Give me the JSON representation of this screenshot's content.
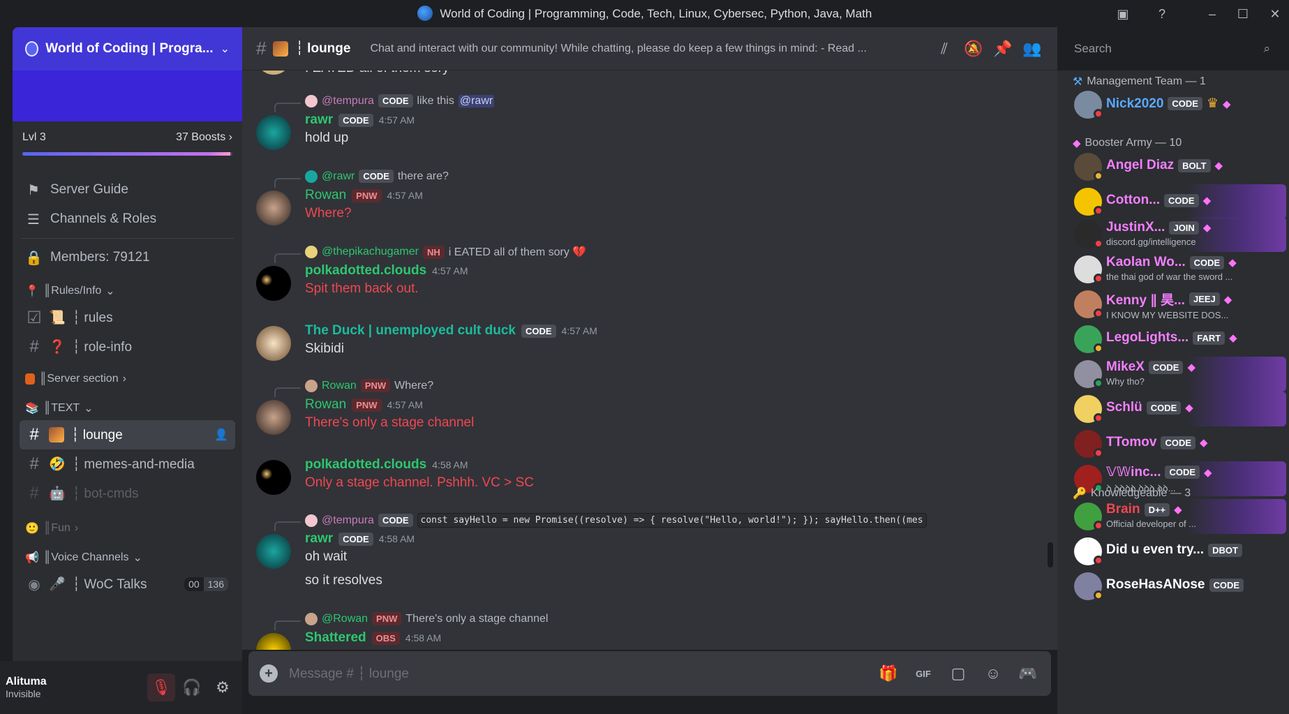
{
  "window": {
    "title": "World of Coding | Programming, Code, Tech, Linux, Cybersec, Python, Java, Math"
  },
  "server": {
    "name": "World of Coding | Progra...",
    "level": "Lvl 3",
    "boosts": "37 Boosts",
    "boost_progress": 0.99
  },
  "sidebar": {
    "items": [
      {
        "label": "Server Guide"
      },
      {
        "label": "Channels & Roles"
      },
      {
        "label": "Members: 79121"
      }
    ],
    "categories": {
      "rules_info": "║Rules/Info",
      "server_section": "║Server section",
      "text": "║TEXT",
      "fun": "║Fun",
      "voice": "║Voice Channels"
    },
    "channels": {
      "rules": "┆ rules",
      "role_info": "┆ role-info",
      "lounge": "┆ lounge",
      "memes": "┆ memes-and-media",
      "bot_cmds": "┆ bot-cmds",
      "woc_talks": "┆ WoC Talks",
      "woc_talks_count_a": "00",
      "woc_talks_count_b": "136"
    }
  },
  "user": {
    "name": "Alituma",
    "status": "Invisible"
  },
  "header": {
    "channel": "┆ lounge",
    "topic": "Chat and interact with our community! While chatting, please do keep a few things in mind: - Read ...",
    "search_placeholder": "Search"
  },
  "messages": [
    {
      "top_partial": "I EATED all of them sory"
    },
    {
      "reply_user": "@tempura",
      "reply_tag": "CODE",
      "reply_text": "like this",
      "reply_mention": "@rawr",
      "author": "rawr",
      "tag": "CODE",
      "time": "4:57 AM",
      "lines": [
        "hold up"
      ]
    },
    {
      "reply_user": "@rawr",
      "reply_tag": "CODE",
      "reply_text": "there are?",
      "author": "Rowan",
      "tag": "PNW",
      "time": "4:57 AM",
      "lines": [
        "Where?"
      ]
    },
    {
      "reply_user": "@thepikachugamer",
      "reply_tag": "NH",
      "reply_text": "i EATED all of them sory 💔",
      "author": "polkadotted.clouds",
      "time": "4:57 AM",
      "lines": [
        "Spit them back out."
      ]
    },
    {
      "author": "The Duck | unemployed cult duck",
      "tag": "CODE",
      "time": "4:57 AM",
      "lines": [
        "Skibidi"
      ]
    },
    {
      "reply_user": "Rowan",
      "reply_tag": "PNW",
      "reply_text": "Where?",
      "author": "Rowan",
      "tag": "PNW",
      "time": "4:57 AM",
      "lines": [
        "There's only a stage channel"
      ]
    },
    {
      "author": "polkadotted.clouds",
      "time": "4:58 AM",
      "lines": [
        "Only a stage channel. Pshhh. VC > SC"
      ]
    },
    {
      "reply_user": "@tempura",
      "reply_tag": "CODE",
      "reply_code": "const sayHello = new Promise((resolve) => {   resolve(\"Hello, world!\"); });  sayHello.then((mes",
      "author": "rawr",
      "tag": "CODE",
      "time": "4:58 AM",
      "lines": [
        "oh wait",
        "so it resolves"
      ]
    },
    {
      "reply_user": "@Rowan",
      "reply_tag": "PNW",
      "reply_text": "There's only a stage channel",
      "author": "Shattered",
      "tag": "OBS",
      "time": "4:58 AM"
    }
  ],
  "composer": {
    "placeholder": "Message # ┆ lounge"
  },
  "member_list": {
    "roles": [
      {
        "title": "Management Team — 1"
      },
      {
        "title": "Booster Army — 10"
      },
      {
        "title": "Knowledgeable — 3"
      }
    ],
    "members": [
      {
        "name": "Nick2020",
        "tag": "CODE",
        "color": "#5aa9ff"
      },
      {
        "name": "Angel Diaz",
        "tag": "BOLT",
        "color": "#f47fff"
      },
      {
        "name": "Cotton...",
        "tag": "CODE",
        "color": "#f47fff"
      },
      {
        "name": "JustinX...",
        "tag": "JOIN",
        "color": "#f47fff",
        "sub": "discord.gg/intelligence"
      },
      {
        "name": "Kaolan Wo...",
        "tag": "CODE",
        "color": "#f47fff",
        "sub": "the thai god of war the sword ..."
      },
      {
        "name": "Kenny ∥ 昊...",
        "tag": "JEEJ",
        "color": "#f47fff",
        "sub": "I KNOW MY WEBSITE DOS..."
      },
      {
        "name": "LegoLights...",
        "tag": "FART",
        "color": "#f47fff"
      },
      {
        "name": "MikeX",
        "tag": "CODE",
        "color": "#f47fff",
        "sub": "Why tho?"
      },
      {
        "name": "Schlü",
        "tag": "CODE",
        "color": "#f47fff"
      },
      {
        "name": "TTomov",
        "tag": "CODE",
        "color": "#f47fff"
      },
      {
        "name": "𝕍𝕎inc...",
        "tag": "CODE",
        "color": "#f47fff",
        "sub": "ꝺ ꝺꝺꝺꝺ.ꝺꝺꝺ ꝺꝺ..."
      },
      {
        "name": "Brain",
        "tag": "D++",
        "color": "#f04752",
        "sub": "Official developer of ..."
      },
      {
        "name": "Did u even try...",
        "tag": "DBOT",
        "color": "#ffffff"
      },
      {
        "name": "RoseHasANose",
        "tag": "CODE",
        "color": "#ffffff"
      }
    ]
  },
  "colors": {
    "rawr": "#2dc770",
    "rowan": "#2dc770",
    "polka": "#2dc770",
    "duck": "#1abc9c",
    "shattered": "#2dc770",
    "red_text": "#f04752"
  }
}
